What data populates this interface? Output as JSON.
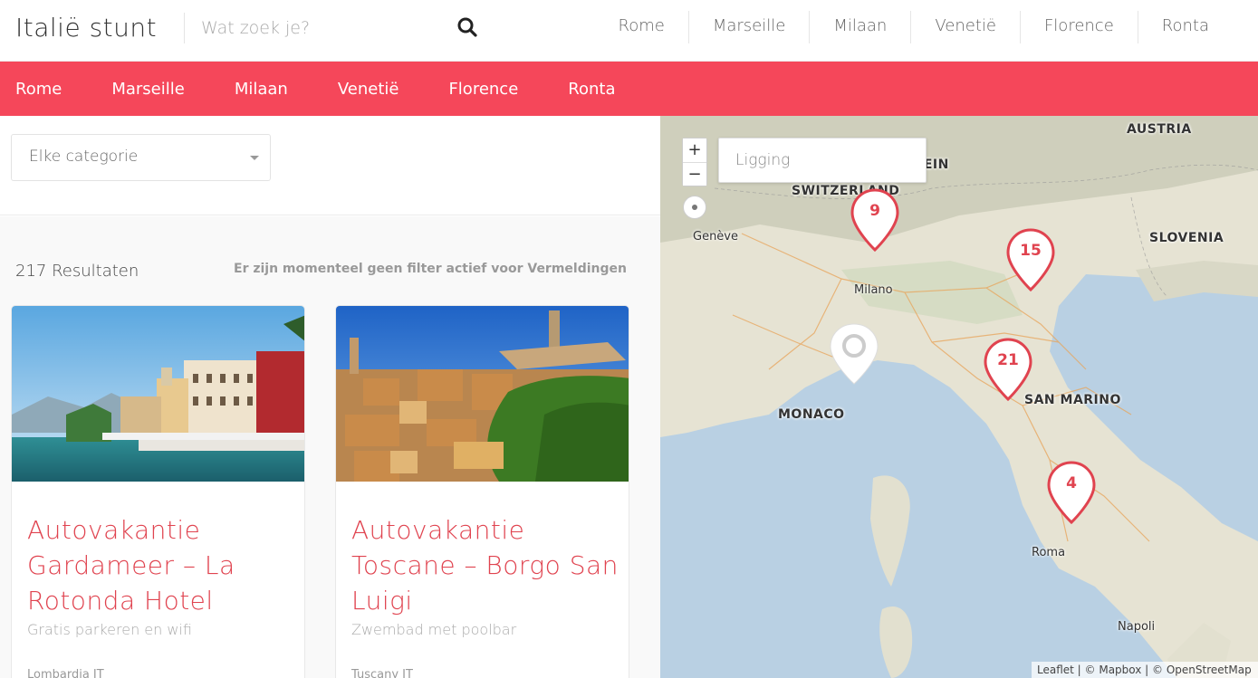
{
  "header": {
    "logo": "Italië stunt",
    "search_placeholder": "Wat zoek je?",
    "nav": [
      "Rome",
      "Marseille",
      "Milaan",
      "Venetië",
      "Florence",
      "Ronta"
    ]
  },
  "rednav": [
    "Rome",
    "Marseille",
    "Milaan",
    "Venetië",
    "Florence",
    "Ronta"
  ],
  "filters": {
    "category": "Elke categorie"
  },
  "results": {
    "count": "217 Resultaten",
    "note": "Er zijn momenteel geen filter actief voor Vermeldingen"
  },
  "cards": [
    {
      "title": "Autovakantie Gardameer – La Rotonda Hotel",
      "subtitle": "Gratis parkeren en wifi",
      "location": "Lombardia IT"
    },
    {
      "title": "Autovakantie Toscane – Borgo San Luigi",
      "subtitle": "Zwembad met poolbar",
      "location": "Tuscany IT"
    }
  ],
  "map": {
    "zoom_in": "+",
    "zoom_out": "−",
    "location_placeholder": "Ligging",
    "attribution": "Leaflet | © Mapbox | © OpenStreetMap",
    "country_labels": [
      "AUSTRIA",
      "SWITZERLAND",
      "NSTEIN",
      "SLOVENIA",
      "MONACO",
      "SAN MARINO"
    ],
    "city_labels": [
      "Genève",
      "Milano",
      "Roma",
      "Napoli"
    ],
    "markers": [
      "9",
      "15",
      "21",
      "4"
    ]
  },
  "colors": {
    "accent": "#f5475a",
    "title_red": "#e0434f"
  }
}
